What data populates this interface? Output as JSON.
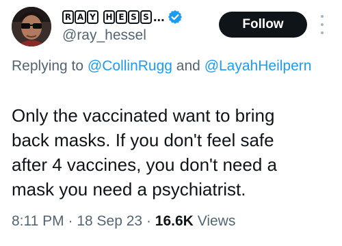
{
  "author": {
    "display_name_letters": [
      "R",
      "A",
      "Y",
      "H",
      "E",
      "S",
      "S"
    ],
    "display_name_ellipsis": "...",
    "handle": "@ray_hessel",
    "verified": true
  },
  "follow_label": "Follow",
  "reply": {
    "prefix": "Replying to",
    "mentions": [
      "@CollinRugg",
      "@LayahHeilpern"
    ],
    "conjunction": "and"
  },
  "tweet_text": "Only the vaccinated want to bring\nback masks. If you don't feel safe\nafter 4 vaccines, you don't need a\nmask you need a psychiatrist.",
  "meta": {
    "time": "8:11 PM",
    "date": "18 Sep 23",
    "separator": "·",
    "views_count": "16.6K",
    "views_label": "Views"
  },
  "colors": {
    "text_primary": "#0f1419",
    "text_secondary": "#536471",
    "link": "#1d9bf0",
    "verified": "#1d9bf0",
    "follow_bg": "#0f1419",
    "follow_text": "#ffffff"
  },
  "icons": {
    "verified": "verified-badge-icon",
    "more": "more-vertical-icon"
  }
}
